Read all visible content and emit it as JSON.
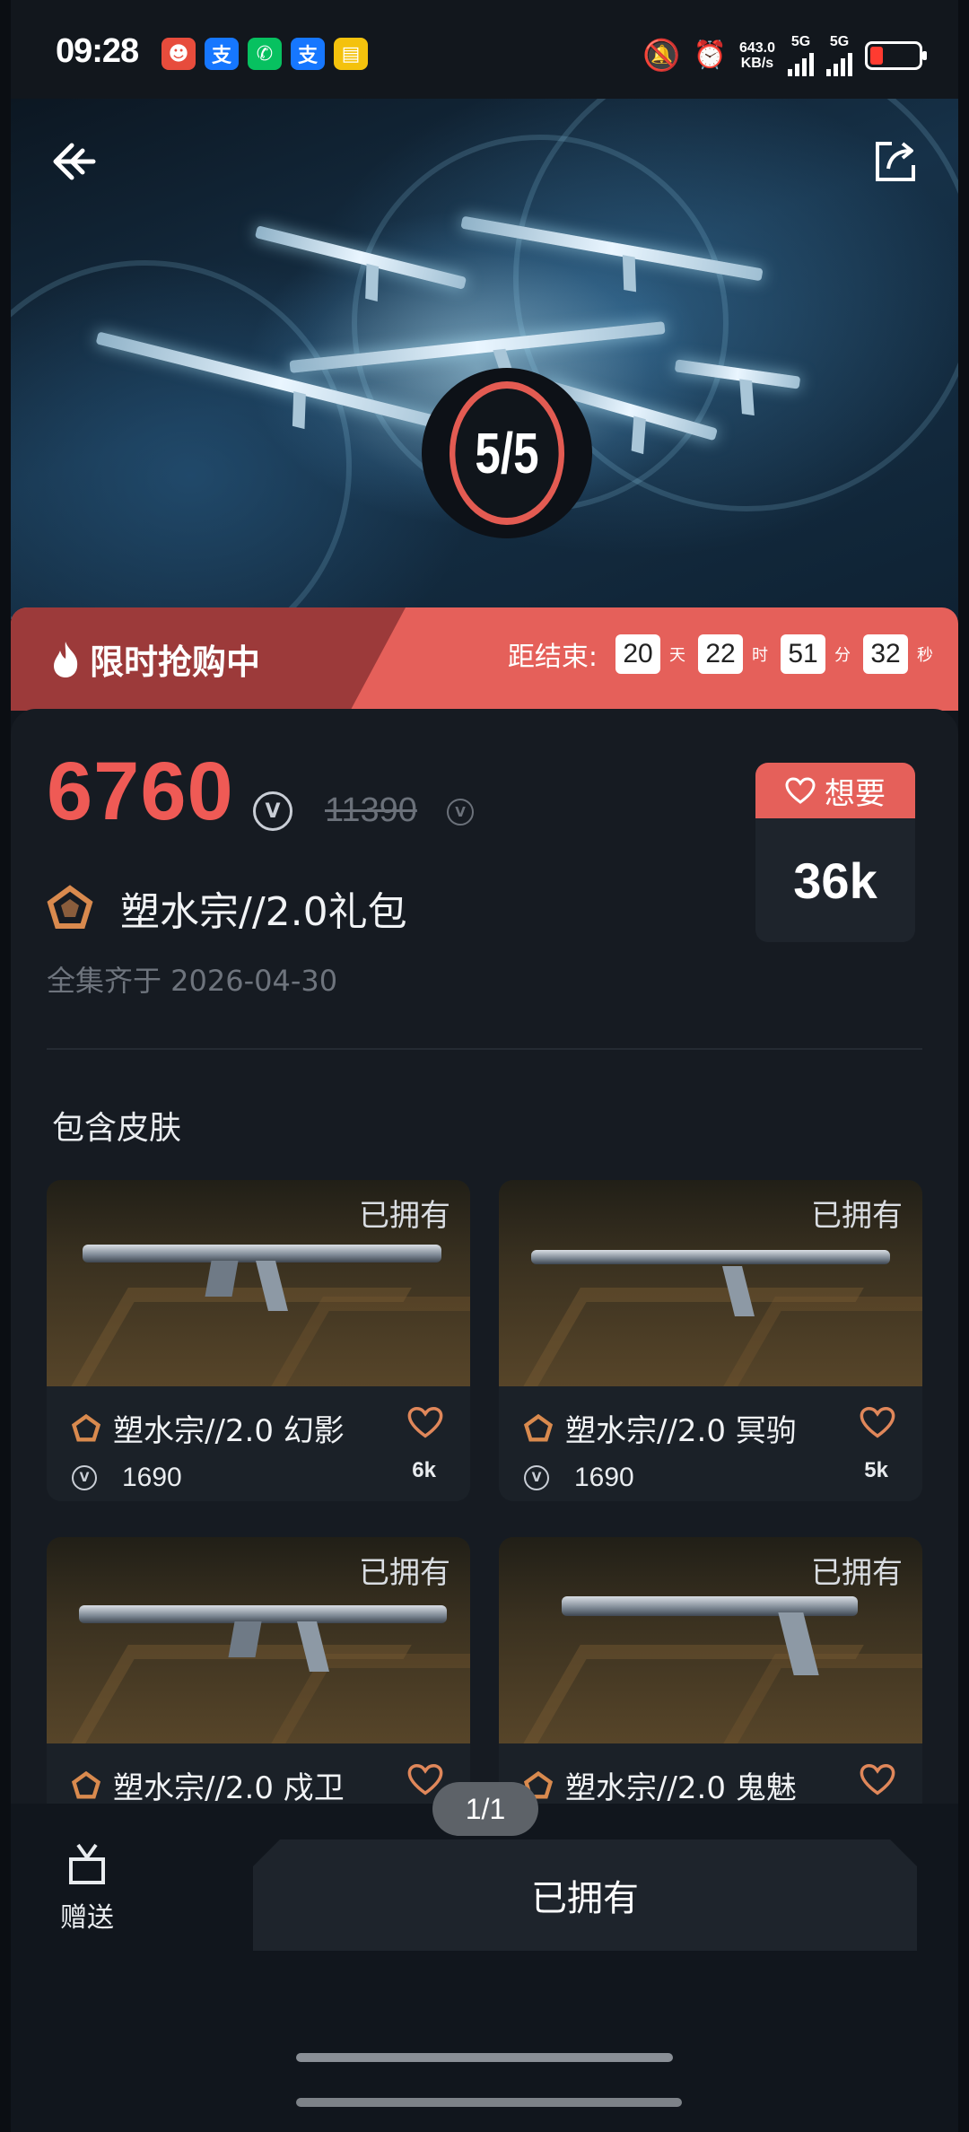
{
  "status_bar": {
    "time": "09:28",
    "apps": [
      {
        "icon": "app-red-icon",
        "label": "",
        "color": "#e74c3c"
      },
      {
        "icon": "alipay-icon",
        "label": "支",
        "color": "#1677ff"
      },
      {
        "icon": "wechat-icon",
        "label": "",
        "color": "#07c160"
      },
      {
        "icon": "alipay-icon",
        "label": "支",
        "color": "#1677ff"
      },
      {
        "icon": "app-yellow-icon",
        "label": "",
        "color": "#f4c20d"
      }
    ],
    "net_speed": "643.0",
    "net_unit": "KB/s",
    "signal1": "5G",
    "signal2": "5G"
  },
  "hero": {
    "progress_badge": "5/5",
    "progress_fraction": 1.0
  },
  "flash_sale": {
    "title": "限时抢购中",
    "countdown_label": "距结束:",
    "days": "20",
    "days_unit": "天",
    "hours": "22",
    "hours_unit": "时",
    "minutes": "51",
    "minutes_unit": "分",
    "seconds": "32",
    "seconds_unit": "秒"
  },
  "bundle": {
    "price": "6760",
    "original_price": "11390",
    "name": "塑水宗//2.0礼包",
    "complete_text": "全集齐于 2026-04-30",
    "wish_label": "想要",
    "wish_count": "36k"
  },
  "section_title": "包含皮肤",
  "skins": [
    {
      "owned": "已拥有",
      "name": "塑水宗//2.0 幻影",
      "price": "1690",
      "wish": "6k"
    },
    {
      "owned": "已拥有",
      "name": "塑水宗//2.0 冥驹",
      "price": "1690",
      "wish": "5k"
    },
    {
      "owned": "已拥有",
      "name": "塑水宗//2.0 戍卫",
      "price": "",
      "wish": ""
    },
    {
      "owned": "已拥有",
      "name": "塑水宗//2.0 鬼魅",
      "price": "",
      "wish": ""
    }
  ],
  "bottom": {
    "pager": "1/1",
    "gift_label": "赠送",
    "owned_button": "已拥有"
  },
  "colors": {
    "accent": "#e5605a",
    "flash_dark": "#9c3a3a",
    "tier_orange": "#d98a4e",
    "bg": "#11161d"
  }
}
